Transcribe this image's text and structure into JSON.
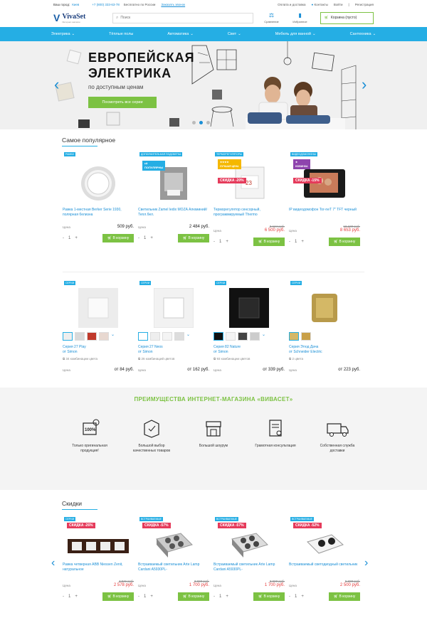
{
  "topbar": {
    "city_label": "Ваш город:",
    "city": "Киев",
    "phone": "+7 (800) 333-63-78",
    "free": "Бесплатно по России",
    "callme": "Заказать звонок",
    "payment": "Оплата и доставка",
    "contacts": "Контакты",
    "login": "Войти",
    "register": "Регистрация"
  },
  "header": {
    "logo": "VivaSet",
    "logo_sub": "Интернет-магазин",
    "search_placeholder": "Поиск",
    "compare": "Сравнение",
    "favorites": "Избранное",
    "cart": "Корзина (пусто)"
  },
  "nav": [
    "Электрика",
    "Тёплые полы",
    "Автоматика",
    "Свет",
    "Мебель для ванной",
    "Сантехника"
  ],
  "hero": {
    "title1": "ЕВРОПЕЙСКАЯ",
    "title2": "ЭЛЕКТРИКА",
    "subtitle": "по доступным ценам",
    "button": "Посмотреть все серии",
    "slides": 3,
    "active_slide": 2
  },
  "popular": {
    "heading": "Самое популярное",
    "price_label": "Цена",
    "buy": "В корзину",
    "qty": "1",
    "items": [
      {
        "badge": "РАМКИ",
        "name": "Рамка 1-местная Berker Serie 1930, полярная белизна",
        "price": "509 руб."
      },
      {
        "badge": "ДОПОЛНИТЕЛЬНАЯ ПОДСВЕТКА",
        "tag": "ПОПУЛЯРНЫ",
        "name": "Светильник Zamel ledix MOZA Алюминий/Тепл.бел.",
        "price": "2 484 руб."
      },
      {
        "badge": "ТЕРМОРЕГУЛЯТОРЫ",
        "tag": "ЛУЧШАЯ ЦЕНА",
        "discount": "СКИДКА -20%",
        "name": "Терморегулятор сенсорный, программируемый Thermo",
        "old": "8 124 руб.",
        "price": "6 500 руб."
      },
      {
        "badge": "ВИДЕОДОМОФОНЫ",
        "tag": "НОВИНКА",
        "discount": "СКИДКА -15%",
        "name": "IP видеодомофон Tor-neT 7\" TFT черный",
        "old": "10 180 руб.",
        "price": "8 653 руб."
      }
    ]
  },
  "series": {
    "items": [
      {
        "badge": "СЕРИИ",
        "name1": "Серия 27 Play",
        "name2": "от Simon",
        "count": "34 комбинации цвета",
        "price": "от 84 руб."
      },
      {
        "badge": "СЕРИИ",
        "name1": "Серия 27 Neos",
        "name2": "от Simon",
        "count": "26 комбинаций цветов",
        "price": "от 162 руб."
      },
      {
        "badge": "СЕРИИ",
        "name1": "Серия 82 Nature",
        "name2": "от Simon",
        "count": "93 комбинации цветов",
        "price": "от 339 руб."
      },
      {
        "badge": "СЕРИИ",
        "name1": "Серия Этюд Дача",
        "name2": "от Schneider Electric",
        "count": "2 цвета",
        "price": "от 223 руб."
      }
    ]
  },
  "advantages": {
    "heading": "ПРЕИМУЩЕСТВА ИНТЕРНЕТ-МАГАЗИНА «ВИВАСЕТ»",
    "items": [
      {
        "l1": "Только оригинальная",
        "l2": "продукция!"
      },
      {
        "l1": "Большой выбор",
        "l2": "качественных товаров"
      },
      {
        "l1": "Большой шоурум",
        "l2": ""
      },
      {
        "l1": "Грамотная консультация",
        "l2": ""
      },
      {
        "l1": "Собственная служба",
        "l2": "доставки"
      }
    ]
  },
  "sale": {
    "heading": "Скидки",
    "items": [
      {
        "badge": "СЕРИИ",
        "discount": "СКИДКА -26%",
        "name": "Рамка четверная ABB Niessen Zenit, натуральное",
        "old": "4 841 руб.",
        "price": "2 578 руб."
      },
      {
        "badge": "ВСТРАИВАЕМЫЕ",
        "discount": "СКИДКА -57%",
        "name": "Встраиваемый светильник Arte Lamp Cardani A5930PL-",
        "old": "3 990 руб.",
        "price": "1 700 руб."
      },
      {
        "badge": "ВСТРАИВАЕМЫЕ",
        "discount": "СКИДКА -57%",
        "name": "Встраиваемый светильник Arte Lamp Cardani A5930PL-",
        "old": "3 990 руб.",
        "price": "1 700 руб."
      },
      {
        "badge": "ВСТРАИВАЕМЫЕ",
        "discount": "СКИДКА -52%",
        "name": "Встраиваемый светодиодный светильник",
        "old": "5 290 руб.",
        "price": "2 500 руб."
      }
    ]
  },
  "colors": {
    "accent": "#25aee4",
    "green": "#7cc243",
    "red": "#e53b5b"
  }
}
